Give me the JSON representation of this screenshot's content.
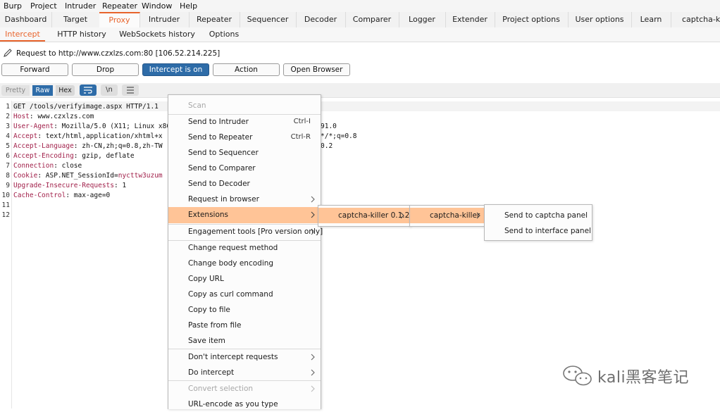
{
  "menubar": [
    "Burp",
    "Project",
    "Intruder",
    "Repeater",
    "Window",
    "Help"
  ],
  "main_tabs": [
    "Dashboard",
    "Target",
    "Proxy",
    "Intruder",
    "Repeater",
    "Sequencer",
    "Decoder",
    "Comparer",
    "Logger",
    "Extender",
    "Project options",
    "User options",
    "Learn",
    "captcha-killer"
  ],
  "main_tab_active": "Proxy",
  "sub_tabs": [
    "Intercept",
    "HTTP history",
    "WebSockets history",
    "Options"
  ],
  "sub_tab_active": "Intercept",
  "request_info": "Request to http://www.czxlzs.com:80  [106.52.214.225]",
  "buttons": {
    "forward": "Forward",
    "drop": "Drop",
    "intercept": "Intercept is on",
    "action": "Action",
    "open_browser": "Open Browser"
  },
  "view_modes": {
    "pretty": "Pretty",
    "raw": "Raw",
    "hex": "Hex"
  },
  "view_mode_active": "Raw",
  "newline_toggle": "\\n",
  "editor": {
    "line_numbers": [
      "1",
      "2",
      "3",
      "4",
      "5",
      "6",
      "7",
      "8",
      "9",
      "10",
      "11",
      "12"
    ],
    "lines": [
      {
        "k": "",
        "v": "GET /tools/verifyimage.aspx HTTP/1.1"
      },
      {
        "k": "Host",
        "v": ": www.czxlzs.com"
      },
      {
        "k": "User-Agent",
        "v": ": Mozilla/5.0 (X11; Linux x86"
      },
      {
        "k": "Accept",
        "v": ": text/html,application/xhtml+x"
      },
      {
        "k": "Accept-Language",
        "v": ": zh-CN,zh;q=0.8,zh-TW"
      },
      {
        "k": "Accept-Encoding",
        "v": ": gzip, deflate"
      },
      {
        "k": "Connection",
        "v": ": close"
      },
      {
        "k": "Cookie",
        "v": ": ASP.NET_SessionId=",
        "c": "nycttw3uzum"
      },
      {
        "k": "Upgrade-Insecure-Requests",
        "v": ": 1"
      },
      {
        "k": "Cache-Control",
        "v": ": max-age=0"
      },
      {
        "k": "",
        "v": ""
      },
      {
        "k": "",
        "v": ""
      }
    ],
    "overflow_fragments": [
      "91.0",
      "*/*;q=0.8",
      "0.2"
    ]
  },
  "context_menu": {
    "items": [
      {
        "label": "Scan",
        "disabled": true
      },
      {
        "label": "Send to Intruder",
        "shortcut": "Ctrl-I"
      },
      {
        "label": "Send to Repeater",
        "shortcut": "Ctrl-R"
      },
      {
        "label": "Send to Sequencer"
      },
      {
        "label": "Send to Comparer"
      },
      {
        "label": "Send to Decoder"
      },
      {
        "label": "Request in browser",
        "submenu": true
      },
      {
        "label": "Extensions",
        "submenu": true,
        "highlighted": true
      },
      {
        "label": "Engagement tools [Pro version only]",
        "submenu": true
      },
      {
        "label": "Change request method"
      },
      {
        "label": "Change body encoding"
      },
      {
        "label": "Copy URL"
      },
      {
        "label": "Copy as curl command"
      },
      {
        "label": "Copy to file"
      },
      {
        "label": "Paste from file"
      },
      {
        "label": "Save item"
      },
      {
        "label": "Don't intercept requests",
        "submenu": true
      },
      {
        "label": "Do intercept",
        "submenu": true
      },
      {
        "label": "Convert selection",
        "submenu": true,
        "disabled": true
      },
      {
        "label": "URL-encode as you type"
      }
    ]
  },
  "extensions_submenu": {
    "label": "captcha-killer 0.1.2"
  },
  "captcha_submenu": {
    "label": "captcha-killer"
  },
  "captcha_actions": [
    "Send to captcha panel",
    "Send to interface panel"
  ],
  "watermark": "kali黑客笔记",
  "colors": {
    "accent": "#e8642c",
    "intercept_on": "#2e6ca8",
    "menu_highlight": "#ffc497",
    "header_key": "#a1204a"
  }
}
